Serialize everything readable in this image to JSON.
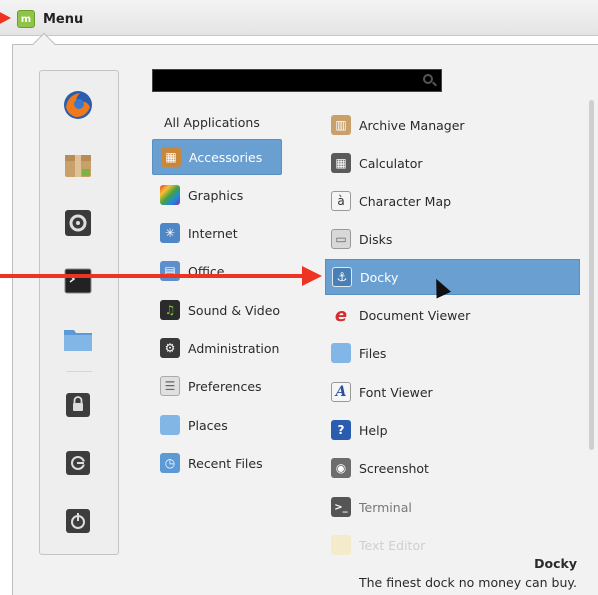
{
  "panel": {
    "menu_label": "Menu"
  },
  "search": {
    "value": "",
    "placeholder": ""
  },
  "favorites": [
    {
      "name": "firefox-icon"
    },
    {
      "name": "package-icon"
    },
    {
      "name": "settings-icon"
    },
    {
      "name": "terminal-icon"
    },
    {
      "name": "folder-icon"
    },
    {
      "name": "lock-icon"
    },
    {
      "name": "logout-icon"
    },
    {
      "name": "power-icon"
    }
  ],
  "categories": [
    {
      "label": "All Applications"
    },
    {
      "label": "Accessories",
      "selected": true
    },
    {
      "label": "Graphics"
    },
    {
      "label": "Internet"
    },
    {
      "label": "Office"
    },
    {
      "label": "Sound & Video"
    },
    {
      "label": "Administration"
    },
    {
      "label": "Preferences"
    },
    {
      "label": "Places"
    },
    {
      "label": "Recent Files"
    }
  ],
  "apps": [
    {
      "label": "Archive Manager"
    },
    {
      "label": "Calculator"
    },
    {
      "label": "Character Map"
    },
    {
      "label": "Disks"
    },
    {
      "label": "Docky",
      "selected": true
    },
    {
      "label": "Document Viewer"
    },
    {
      "label": "Files"
    },
    {
      "label": "Font Viewer"
    },
    {
      "label": "Help"
    },
    {
      "label": "Screenshot"
    },
    {
      "label": "Terminal"
    },
    {
      "label": "Text Editor"
    }
  ],
  "description": {
    "title": "Docky",
    "text": "The finest dock no money can buy."
  },
  "colors": {
    "selection": "#6a9fd1",
    "annotation_arrow": "#ee3322"
  }
}
